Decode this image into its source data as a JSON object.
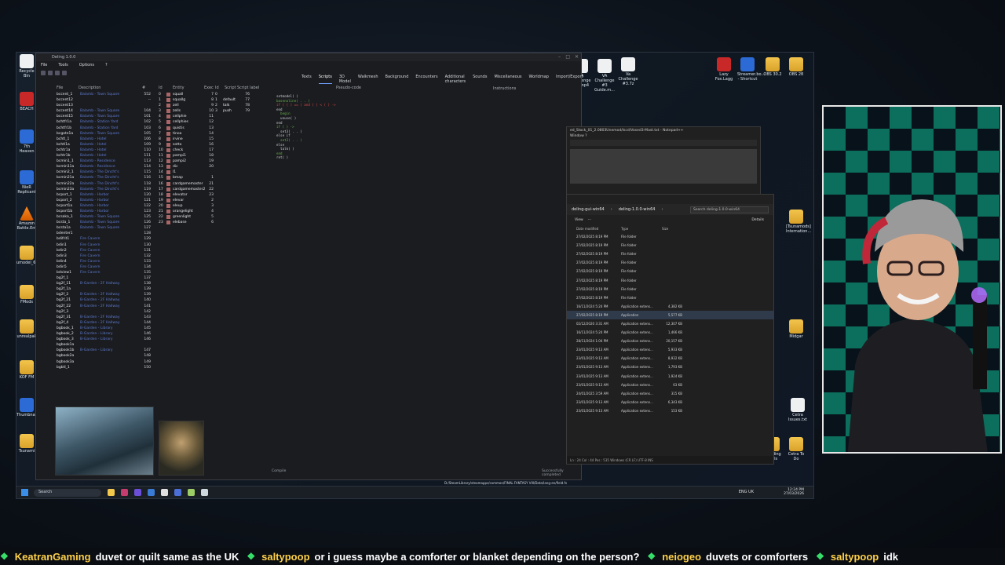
{
  "editor": {
    "title": "Deling 1.0.0",
    "menu": [
      "File",
      "Tools",
      "Options",
      "?"
    ],
    "tabs": [
      "Texts",
      "Scripts",
      "3D Model",
      "Walkmesh",
      "Background",
      "Encounters",
      "Additional characters",
      "Sounds",
      "Miscellaneous",
      "Worldmap",
      "Import/Export"
    ],
    "active_tab": "Scripts",
    "field_list_headers": [
      "File",
      "Description",
      "#"
    ],
    "fields": [
      {
        "name": "bccent_1",
        "desc": "Balamb - Town Square",
        "num": "552"
      },
      {
        "name": "bccent12",
        "desc": "",
        "num": "--"
      },
      {
        "name": "bccent13",
        "desc": "",
        "num": ""
      },
      {
        "name": "bccent14",
        "desc": "Balamb - Town Square",
        "num": "104"
      },
      {
        "name": "bccent15",
        "desc": "Balamb - Town Square",
        "num": "101"
      },
      {
        "name": "bchtfr1a",
        "desc": "Balamb - Station Yard",
        "num": "102"
      },
      {
        "name": "bchtfr1b",
        "desc": "Balamb - Station Yard",
        "num": "103"
      },
      {
        "name": "bcgate1a",
        "desc": "Balamb - Town Square",
        "num": "105"
      },
      {
        "name": "bchtl_1",
        "desc": "Balamb - Hotel",
        "num": "106"
      },
      {
        "name": "bchtl1a",
        "desc": "Balamb - Hotel",
        "num": "109"
      },
      {
        "name": "bchtr1a",
        "desc": "Balamb - Hotel",
        "num": "110"
      },
      {
        "name": "bchtr1b",
        "desc": "Balamb - Hotel",
        "num": "111"
      },
      {
        "name": "bcmin1_1",
        "desc": "Balamb - Residence",
        "num": "113"
      },
      {
        "name": "bcmin11a",
        "desc": "Balamb - Residence",
        "num": "114"
      },
      {
        "name": "bcmin2_1",
        "desc": "Balamb - The Dincht's",
        "num": "115"
      },
      {
        "name": "bcmin21a",
        "desc": "Balamb - The Dincht's",
        "num": "116"
      },
      {
        "name": "bcmin22a",
        "desc": "Balamb - The Dincht's",
        "num": "118"
      },
      {
        "name": "bcmin23a",
        "desc": "Balamb - The Dincht's",
        "num": "119"
      },
      {
        "name": "bcport_1",
        "desc": "Balamb - Harbor",
        "num": "120"
      },
      {
        "name": "bcport_2",
        "desc": "Balamb - Harbor",
        "num": "121"
      },
      {
        "name": "bcport1a",
        "desc": "Balamb - Harbor",
        "num": "122"
      },
      {
        "name": "bcport1b",
        "desc": "Balamb - Harbor",
        "num": "123"
      },
      {
        "name": "bcsaka_1",
        "desc": "Balamb - Town Square",
        "num": "125"
      },
      {
        "name": "bcsta_1",
        "desc": "Balamb - Town Square",
        "num": "126"
      },
      {
        "name": "bcsta1a",
        "desc": "Balamb - Town Square",
        "num": "127"
      },
      {
        "name": "bdenter1",
        "desc": "",
        "num": "128"
      },
      {
        "name": "bdifrit1",
        "desc": "Fire Cavern",
        "num": "129"
      },
      {
        "name": "bdin1",
        "desc": "Fire Cavern",
        "num": "130"
      },
      {
        "name": "bdin2",
        "desc": "Fire Cavern",
        "num": "131"
      },
      {
        "name": "bdin3",
        "desc": "Fire Cavern",
        "num": "132"
      },
      {
        "name": "bdin4",
        "desc": "Fire Cavern",
        "num": "133"
      },
      {
        "name": "bdin5",
        "desc": "Fire Cavern",
        "num": "134"
      },
      {
        "name": "bdview1",
        "desc": "Fire Cavern",
        "num": "135"
      },
      {
        "name": "bg2f_1",
        "desc": "",
        "num": "137"
      },
      {
        "name": "bg2f_11",
        "desc": "B-Garden - 2F Hallway",
        "num": "138"
      },
      {
        "name": "bg2f_1a",
        "desc": "",
        "num": "139"
      },
      {
        "name": "bg2f_2",
        "desc": "B-Garden - 2F Hallway",
        "num": "139"
      },
      {
        "name": "bg2f_21",
        "desc": "B-Garden - 2F Hallway",
        "num": "140"
      },
      {
        "name": "bg2f_22",
        "desc": "B-Garden - 2F Hallway",
        "num": "141"
      },
      {
        "name": "bg2f_3",
        "desc": "",
        "num": "142"
      },
      {
        "name": "bg2f_31",
        "desc": "B-Garden - 2F Hallway",
        "num": "143"
      },
      {
        "name": "bg2f_4",
        "desc": "B-Garden - 2F Hallway",
        "num": "144"
      },
      {
        "name": "bgbook_1",
        "desc": "B-Garden - Library",
        "num": "145"
      },
      {
        "name": "bgbook_2",
        "desc": "B-Garden - Library",
        "num": "146"
      },
      {
        "name": "bgbook_3",
        "desc": "B-Garden - Library",
        "num": "146"
      },
      {
        "name": "bgbook1a",
        "desc": "",
        "num": ""
      },
      {
        "name": "bgbook1b",
        "desc": "B-Garden - Library",
        "num": "147"
      },
      {
        "name": "bgbook2a",
        "desc": "",
        "num": "148"
      },
      {
        "name": "bgbook3a",
        "desc": "",
        "num": "149"
      },
      {
        "name": "bgbtl_1",
        "desc": "",
        "num": "150"
      }
    ],
    "entity_headers": [
      "Id",
      "Entity",
      "Exec"
    ],
    "entities": [
      {
        "id": "0",
        "name": "squall",
        "exec": "7"
      },
      {
        "id": "1",
        "name": "squallg",
        "exec": "8"
      },
      {
        "id": "2",
        "name": "zell",
        "exec": "9"
      },
      {
        "id": "3",
        "name": "zells",
        "exec": "10"
      },
      {
        "id": "4",
        "name": "cellphie",
        "exec": "11"
      },
      {
        "id": "5",
        "name": "cellphies",
        "exec": "12"
      },
      {
        "id": "6",
        "name": "quistis",
        "exec": "13"
      },
      {
        "id": "7",
        "name": "tinoa",
        "exec": "14"
      },
      {
        "id": "8",
        "name": "irvine",
        "exec": "15"
      },
      {
        "id": "9",
        "name": "sotto",
        "exec": "16"
      },
      {
        "id": "10",
        "name": "check",
        "exec": "17"
      },
      {
        "id": "11",
        "name": "pampi1",
        "exec": "18"
      },
      {
        "id": "12",
        "name": "pampi2",
        "exec": "19"
      },
      {
        "id": "13",
        "name": "dic",
        "exec": "20"
      },
      {
        "id": "14",
        "name": "l1",
        "exec": ""
      },
      {
        "id": "15",
        "name": "bmap",
        "exec": "1"
      },
      {
        "id": "16",
        "name": "cardgamemaster",
        "exec": "21"
      },
      {
        "id": "17",
        "name": "cardgamemaster2",
        "exec": "22"
      },
      {
        "id": "18",
        "name": "elevator",
        "exec": "23"
      },
      {
        "id": "19",
        "name": "elevar",
        "exec": "2"
      },
      {
        "id": "20",
        "name": "eleup",
        "exec": "3"
      },
      {
        "id": "21",
        "name": "orangelight",
        "exec": "4"
      },
      {
        "id": "22",
        "name": "greenlight",
        "exec": "5"
      },
      {
        "id": "23",
        "name": "elebase",
        "exec": "6"
      }
    ],
    "script_headers": [
      "Id",
      "Script",
      "Script label"
    ],
    "scripts": [
      {
        "id": "0",
        "name": "",
        "label": "76"
      },
      {
        "id": "1",
        "name": "default",
        "label": "77"
      },
      {
        "id": "2",
        "name": "talk",
        "label": "78"
      },
      {
        "id": "3",
        "name": "push",
        "label": "79"
      }
    ],
    "code_header": "Pseudo-code",
    "instructions_label": "Instructions",
    "code_lines": [
      "setmodel( )",
      "basenoline( . . )",
      "if ( ( ) == ) and ( ) < ( ) ->",
      "end",
      "  begin",
      "  unuse( )",
      "end",
      "if ( ) ->",
      "  set3( . . )",
      "else if",
      "  set3( . . )",
      "else",
      "  talk( )",
      "end",
      "ret( )"
    ],
    "compile_label": "Compile",
    "status_left": "Compile",
    "status_right": "Successfully completed",
    "path_text": "D:/SteamLibrary/steamapps/common/FINAL FANTASY VIII/Data/lang-en/field.fs"
  },
  "notepad": {
    "title": "ed_Stock_01_2.0803Unemod/Iscd/Vosed3-Mast.txt - Notepad++",
    "menu": "Window ?"
  },
  "explorer": {
    "breadcrumbs": [
      "deling-gui-win64",
      "deling-1.0.0-win64"
    ],
    "search_placeholder": "Search deling-1.0.0-win64",
    "view_label": "View",
    "details_label": "Details",
    "columns": [
      "Date modified",
      "Type",
      "Size"
    ],
    "rows": [
      {
        "date": "27/02/2025 8:19 PM",
        "type": "File folder",
        "size": ""
      },
      {
        "date": "27/02/2025 8:19 PM",
        "type": "File folder",
        "size": ""
      },
      {
        "date": "27/02/2025 8:19 PM",
        "type": "File folder",
        "size": ""
      },
      {
        "date": "27/02/2025 8:19 PM",
        "type": "File folder",
        "size": ""
      },
      {
        "date": "27/02/2025 8:19 PM",
        "type": "File folder",
        "size": ""
      },
      {
        "date": "27/02/2025 8:19 PM",
        "type": "File folder",
        "size": ""
      },
      {
        "date": "27/02/2025 8:19 PM",
        "type": "File folder",
        "size": ""
      },
      {
        "date": "27/02/2025 8:19 PM",
        "type": "File folder",
        "size": ""
      },
      {
        "date": "16/11/2024 5:24 PM",
        "type": "Application extens...",
        "size": "4,382 KB"
      },
      {
        "date": "27/02/2025 8:19 PM",
        "type": "Application",
        "size": "5,577 KB"
      },
      {
        "date": "02/12/2020 3:31 AM",
        "type": "Application extens...",
        "size": "12,307 KB"
      },
      {
        "date": "16/11/2024 5:24 PM",
        "type": "Application extens...",
        "size": "1,466 KB"
      },
      {
        "date": "28/11/2024 1:04 PM",
        "type": "Application extens...",
        "size": "20,157 KB"
      },
      {
        "date": "23/01/2025 9:13 AM",
        "type": "Application extens...",
        "size": "5,933 KB"
      },
      {
        "date": "23/01/2025 9:13 AM",
        "type": "Application extens...",
        "size": "8,932 KB"
      },
      {
        "date": "23/01/2025 9:13 AM",
        "type": "Application extens...",
        "size": "1,793 KB"
      },
      {
        "date": "23/01/2025 9:13 AM",
        "type": "Application extens...",
        "size": "1,924 KB"
      },
      {
        "date": "23/01/2025 9:13 AM",
        "type": "Application extens...",
        "size": "63 KB"
      },
      {
        "date": "24/01/2025 3:59 AM",
        "type": "Application extens...",
        "size": "315 KB"
      },
      {
        "date": "23/01/2025 9:13 AM",
        "type": "Application extens...",
        "size": "6,343 KB"
      },
      {
        "date": "23/01/2025 9:13 AM",
        "type": "Application extens...",
        "size": "153 KB"
      }
    ],
    "status": "Ln : 24  Col : 44  Pos : 535        Windows (CR LF)    UTF-8         INS"
  },
  "desktop_icons": {
    "top": [
      "VA Challenge #3.mp4",
      "VA Challenge #3 Guide.m...",
      "Va Challenge #3.7z",
      "Lazy Fox.Lagg",
      "Streamer.bo... - Shortcut",
      "OBS 30.2",
      "OBS 28"
    ],
    "left": [
      "Recycle Bin",
      "BEACH",
      "7th Heaven",
      "NieR Replicant",
      "Amazon Battle.Ent",
      "umodel_64",
      "FMods",
      "unrealpak",
      "KOF FM",
      "Thumbnail",
      "Tsunami"
    ],
    "right": [
      "[Tsunamods] Internation...",
      "Midgar",
      "Cetra Issues.txt",
      "Modding Tools",
      "Cetra To Do"
    ]
  },
  "taskbar": {
    "search_label": "Search",
    "lang": "ENG UK",
    "time": "12:24 PM",
    "date": "27/03/2026"
  },
  "chat": [
    {
      "user": "KeatranGaming",
      "msg": "duvet or quilt same as the UK"
    },
    {
      "user": "saltypoop",
      "msg": "or i guess maybe a comforter or blanket depending on the person?"
    },
    {
      "user": "neiogeo",
      "msg": "duvets or comforters"
    },
    {
      "user": "saltypoop",
      "msg": "idk"
    }
  ],
  "colors": {
    "chat_user": "#ffd24a",
    "chat_badge": "#37e06b",
    "field_desc": "#5c7bd1",
    "webcam_wall_green": "#0c6e5c"
  }
}
